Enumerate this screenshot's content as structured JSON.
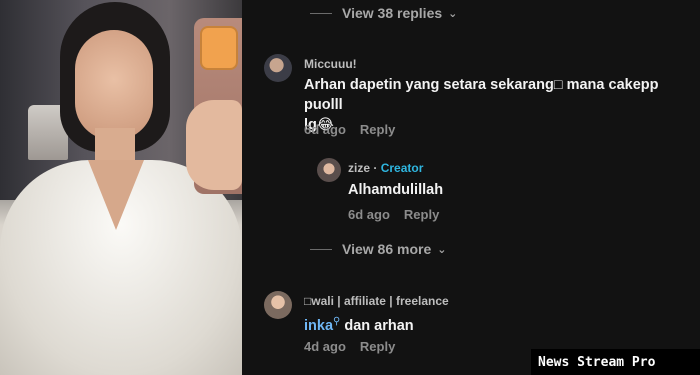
{
  "thread": {
    "view_replies_top": "View 38 replies",
    "view_more_mid": "View 86 more",
    "chevron_icon": "chevron-down-icon"
  },
  "comments": [
    {
      "username": "Miccuuu!",
      "text_line1": "Arhan dapetin yang setara sekarang□ mana cakepp puolll",
      "text_line2": "lg😂",
      "time": "6d ago",
      "reply": "Reply"
    },
    {
      "username": "zize",
      "separator": "·",
      "badge": "Creator",
      "text": "Alhamdulillah",
      "time": "6d ago",
      "reply": "Reply"
    },
    {
      "username": "□wali | affiliate | freelance",
      "mention": "inka",
      "text": "dan arhan",
      "time": "4d ago",
      "reply": "Reply"
    }
  ],
  "watermark": "News Stream Pro"
}
